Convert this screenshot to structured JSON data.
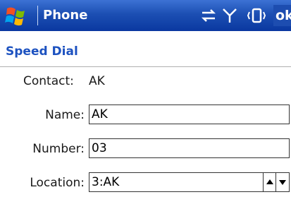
{
  "titlebar": {
    "app_title": "Phone",
    "ok_label": "ok",
    "icons": [
      "windows-start-icon",
      "connectivity-icon",
      "signal-icon",
      "vibrate-icon"
    ]
  },
  "page": {
    "title": "Speed Dial"
  },
  "form": {
    "contact_label": "Contact:",
    "contact_value": "AK",
    "name_label": "Name:",
    "name_value": "AK",
    "number_label": "Number:",
    "number_value": "03",
    "location_label": "Location:",
    "location_value": "3:AK"
  },
  "colors": {
    "titlebar": "#1c4fb3",
    "accent_text": "#1d52c0"
  }
}
